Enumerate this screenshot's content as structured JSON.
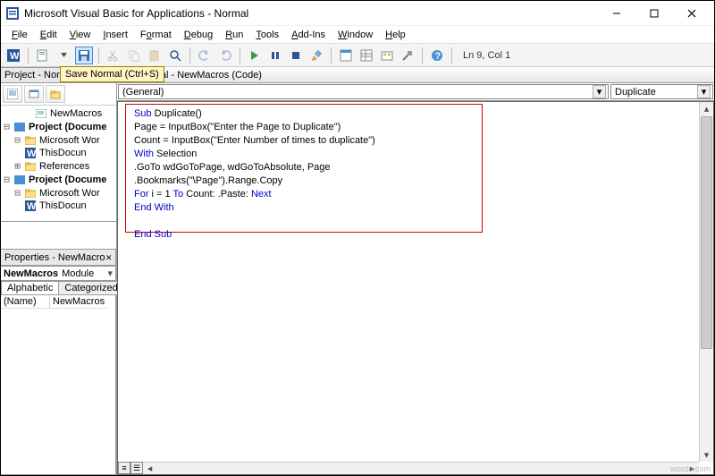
{
  "titlebar": {
    "title": "Microsoft Visual Basic for Applications - Normal"
  },
  "menu": {
    "file": "File",
    "edit": "Edit",
    "view": "View",
    "insert": "Insert",
    "format": "Format",
    "debug": "Debug",
    "run": "Run",
    "tools": "Tools",
    "addins": "Add-Ins",
    "window": "Window",
    "help": "Help"
  },
  "toolbar": {
    "cursor_status": "Ln 9, Col 1"
  },
  "tooltip": {
    "text": "Save Normal (Ctrl+S)"
  },
  "project_panel": {
    "title": "Project - Norm"
  },
  "tree": {
    "newmacros": "NewMacros",
    "proj1": "Project (Docume",
    "word1": "Microsoft Wor",
    "thisdoc1": "ThisDocun",
    "refs": "References",
    "proj2": "Project (Docume",
    "word2": "Microsoft Wor",
    "thisdoc2": "ThisDocun"
  },
  "props_panel": {
    "title": "Properties - NewMacro",
    "object_name": "NewMacros",
    "object_type": "Module",
    "tab_alpha": "Alphabetic",
    "tab_cat": "Categorized",
    "row_name_key": "(Name)",
    "row_name_val": "NewMacros"
  },
  "mdi": {
    "title": "Normal - NewMacros (Code)"
  },
  "dropdowns": {
    "left": "(General)",
    "right": "Duplicate"
  },
  "code": {
    "l1_a": "Sub",
    "l1_b": " Duplicate()",
    "l2": "Page = InputBox(\"Enter the Page to Duplicate\")",
    "l3": "Count = InputBox(\"Enter Number of times to duplicate\")",
    "l4_a": "With",
    "l4_b": " Selection",
    "l5": ".GoTo wdGoToPage, wdGoToAbsolute, Page",
    "l6": ".Bookmarks(\"\\Page\").Range.Copy",
    "l7_a": "For",
    "l7_b": " i = 1 ",
    "l7_c": "To",
    "l7_d": " Count: .Paste: ",
    "l7_e": "Next",
    "l8": "End With",
    "l9": "End Sub"
  },
  "watermark": "wsxdn.com"
}
